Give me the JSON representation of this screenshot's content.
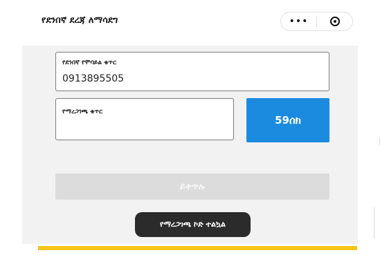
{
  "header": {
    "title": "የደንበኛ ደረጃ ለማሳደግ",
    "more_label": "•••",
    "more_icon": "more-dots-icon",
    "close_icon": "target-icon"
  },
  "form": {
    "phone_label": "የደንበኛ የሞባይል ቁጥር",
    "phone_value": "0913895505",
    "code_label": "የማረጋገጫ ቁጥር",
    "code_value": "",
    "timer_label": "59ሰክ",
    "continue_label": "ይቀጥሉ"
  },
  "toast": {
    "message": "የማረጋገጫ ኮድ ተልኳል"
  },
  "colors": {
    "accent_blue": "#1b8be0",
    "disabled_gray": "#dcdcdc",
    "toast_bg": "#2b2b2b",
    "bottom_bar": "#f5c518",
    "panel_bg": "#f2f2f2"
  }
}
